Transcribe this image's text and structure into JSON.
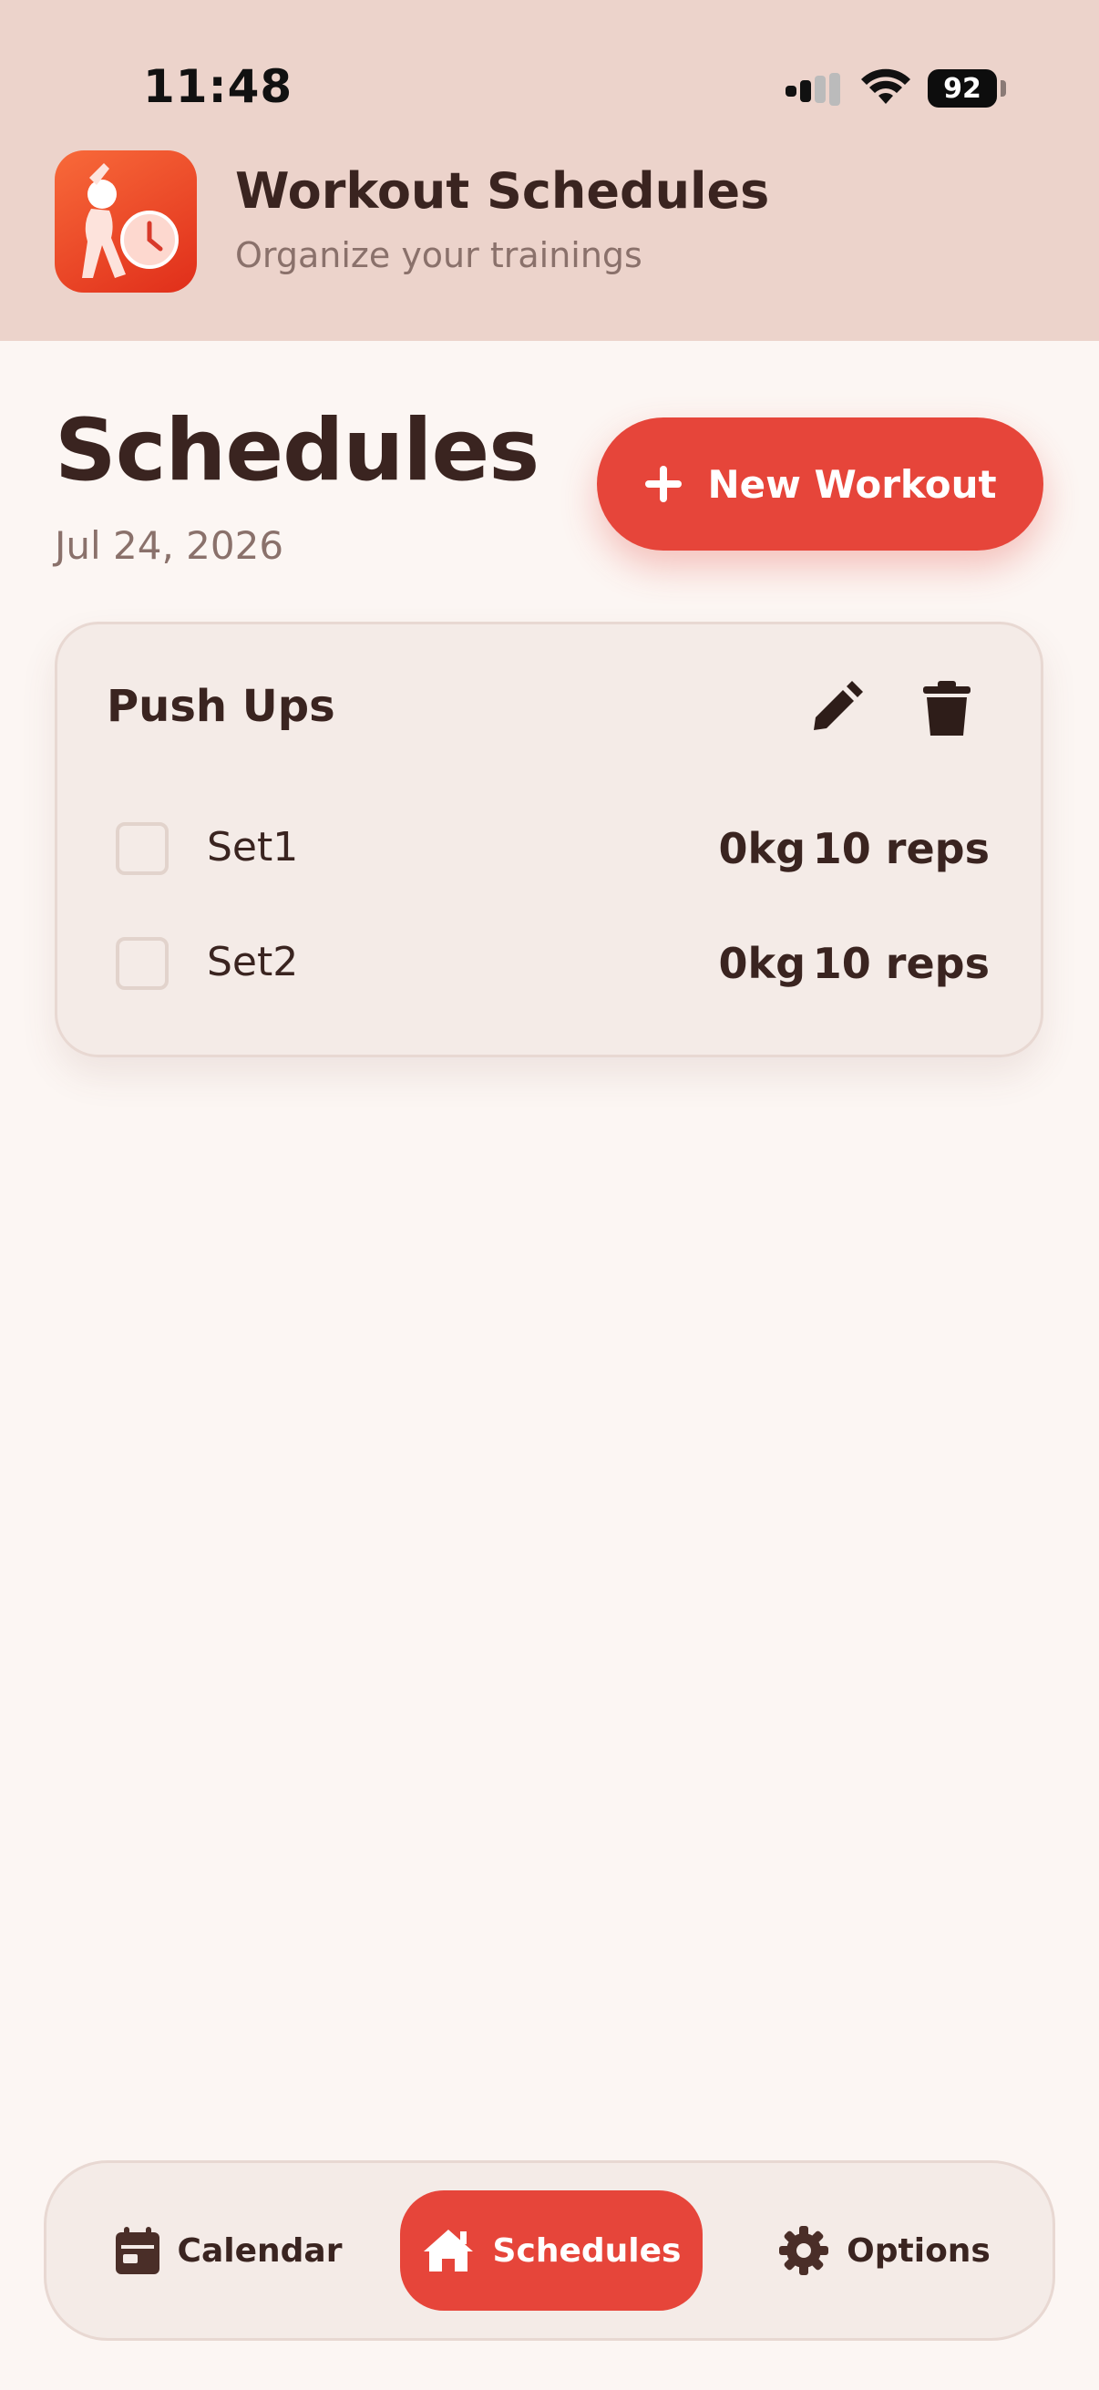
{
  "status_bar": {
    "time": "11:48",
    "battery": "92",
    "icons": [
      "signal-icon",
      "wifi-icon",
      "battery-icon"
    ]
  },
  "app": {
    "title": "Workout Schedules",
    "subtitle": "Organize your trainings",
    "icon": "workout-timer-icon"
  },
  "page": {
    "title": "Schedules",
    "date": "Jul 24, 2026",
    "new_button_label": "New Workout"
  },
  "workouts": [
    {
      "name": "Push Ups",
      "sets": [
        {
          "label": "Set1",
          "weight": "0kg",
          "reps": "10 reps",
          "checked": false
        },
        {
          "label": "Set2",
          "weight": "0kg",
          "reps": "10 reps",
          "checked": false
        }
      ]
    }
  ],
  "nav": {
    "items": [
      {
        "label": "Calendar",
        "icon": "calendar-icon",
        "active": false
      },
      {
        "label": "Schedules",
        "icon": "home-icon",
        "active": true
      },
      {
        "label": "Options",
        "icon": "gear-icon",
        "active": false
      }
    ]
  },
  "colors": {
    "accent": "#e6453a",
    "header_bg": "#ecd3cb",
    "page_bg": "#fcf6f3",
    "card_bg": "#f4ebe7",
    "text": "#3a2420",
    "muted_text": "#8a716b"
  }
}
